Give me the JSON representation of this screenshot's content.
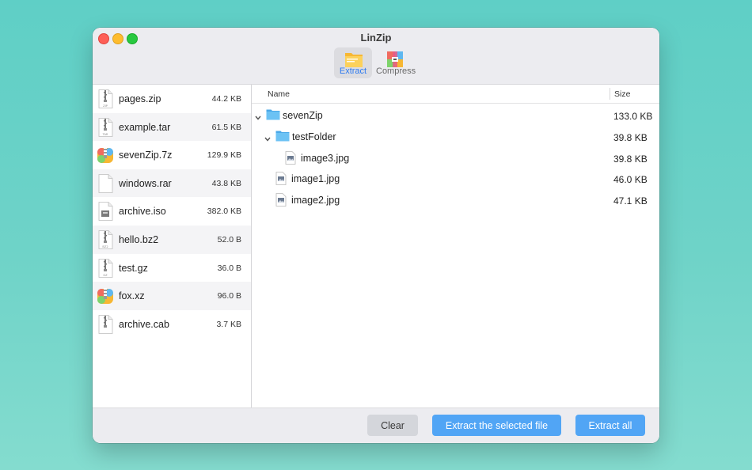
{
  "window": {
    "title": "LinZip"
  },
  "toolbar": {
    "extract_label": "Extract",
    "compress_label": "Compress"
  },
  "sidebar": {
    "archives": [
      {
        "name": "pages.zip",
        "size": "44.2 KB",
        "icon": "zip-file-icon",
        "icon_caption": "ZIP"
      },
      {
        "name": "example.tar",
        "size": "61.5 KB",
        "icon": "tar-file-icon",
        "icon_caption": "TAR"
      },
      {
        "name": "sevenZip.7z",
        "size": "129.9 KB",
        "icon": "sevenzip-file-icon",
        "icon_caption": ""
      },
      {
        "name": "windows.rar",
        "size": "43.8 KB",
        "icon": "rar-file-icon",
        "icon_caption": ""
      },
      {
        "name": "archive.iso",
        "size": "382.0 KB",
        "icon": "iso-file-icon",
        "icon_caption": ""
      },
      {
        "name": "hello.bz2",
        "size": "52.0 B",
        "icon": "bz2-file-icon",
        "icon_caption": "BZ2"
      },
      {
        "name": "test.gz",
        "size": "36.0 B",
        "icon": "gz-file-icon",
        "icon_caption": "GZ"
      },
      {
        "name": "fox.xz",
        "size": "96.0 B",
        "icon": "xz-file-icon",
        "icon_caption": ""
      },
      {
        "name": "archive.cab",
        "size": "3.7 KB",
        "icon": "cab-file-icon",
        "icon_caption": ""
      }
    ]
  },
  "table": {
    "col_name": "Name",
    "col_size": "Size",
    "rows": [
      {
        "name": "sevenZip",
        "size": "133.0 KB",
        "type": "folder",
        "depth": 0,
        "expanded": true
      },
      {
        "name": "testFolder",
        "size": "39.8 KB",
        "type": "folder",
        "depth": 1,
        "expanded": true
      },
      {
        "name": "image3.jpg",
        "size": "39.8 KB",
        "type": "file",
        "depth": 2
      },
      {
        "name": "image1.jpg",
        "size": "46.0 KB",
        "type": "file",
        "depth": 1
      },
      {
        "name": "image2.jpg",
        "size": "47.1 KB",
        "type": "file",
        "depth": 1
      }
    ]
  },
  "footer": {
    "clear_label": "Clear",
    "extract_selected_label": "Extract the selected file",
    "extract_all_label": "Extract all"
  },
  "colors": {
    "accent": "#51a5f5",
    "folder": "#5cb8f0",
    "desktop": "#66d1c7"
  }
}
